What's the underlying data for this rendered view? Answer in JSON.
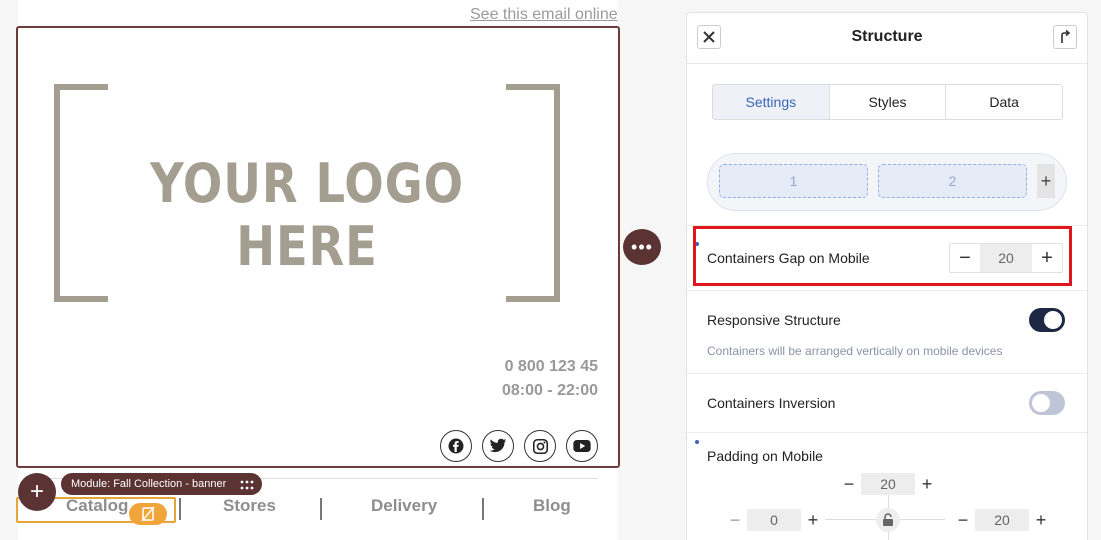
{
  "email": {
    "see_online": "See this email online",
    "logo_text": "YOUR LOGO HERE",
    "phone": "0 800 123 45",
    "hours": "08:00 - 22:00",
    "socials": [
      "facebook-icon",
      "twitter-icon",
      "instagram-icon",
      "youtube-icon"
    ],
    "module_label": "Module: Fall Collection - banner",
    "nav": [
      "Catalog",
      "Stores",
      "Delivery",
      "Blog"
    ]
  },
  "panel": {
    "title": "Structure",
    "tabs": [
      "Settings",
      "Styles",
      "Data"
    ],
    "containers": [
      "1",
      "2"
    ],
    "gap_label": "Containers Gap on Mobile",
    "gap_value": "20",
    "responsive_label": "Responsive Structure",
    "responsive_on": true,
    "responsive_hint": "Containers will be arranged vertically on mobile devices",
    "inversion_label": "Containers Inversion",
    "inversion_on": false,
    "padding_label": "Padding on Mobile",
    "padding_top": "20",
    "padding_left": "0",
    "padding_right": "20"
  },
  "colors": {
    "accent_brown": "#5b3333",
    "selection_orange": "#e9a33b",
    "highlight_red": "#e0161d",
    "tab_active": "#3a63b8",
    "toggle_on": "#1e2744"
  }
}
